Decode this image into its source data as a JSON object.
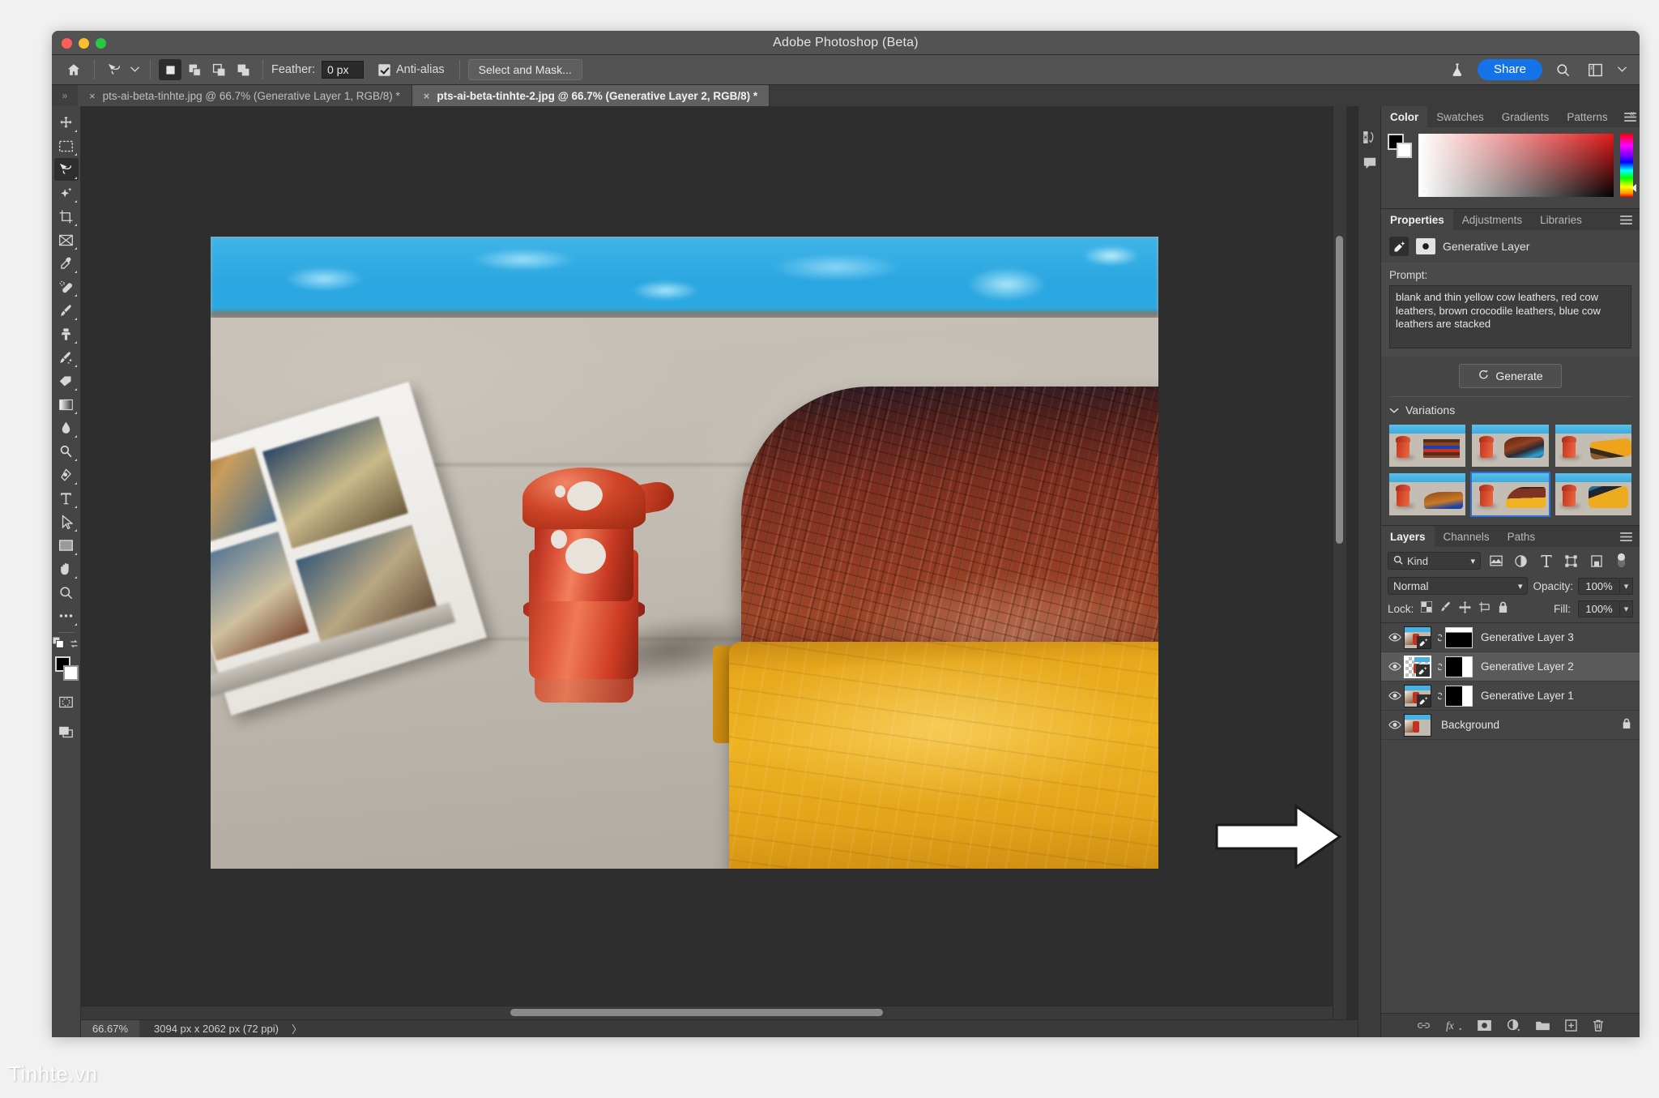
{
  "window": {
    "title": "Adobe Photoshop (Beta)",
    "traffic_lights": [
      "close",
      "minimize",
      "zoom"
    ]
  },
  "options_bar": {
    "home_icon": "home-icon",
    "tool_icon": "lasso-tool-icon",
    "tool_dropdown": "chevron-down-icon",
    "marquee_modes": [
      "new-selection",
      "add-to-selection",
      "subtract-from-selection",
      "intersect-selection"
    ],
    "feather_label": "Feather:",
    "feather_value": "0 px",
    "antialias_label": "Anti-alias",
    "antialias_checked": true,
    "select_and_mask_label": "Select and Mask...",
    "flask_icon": "flask-icon",
    "share_label": "Share",
    "search_icon": "search-icon",
    "workspace_icon": "workspace-icon",
    "workspace_chevron": "chevron-down-icon"
  },
  "tabs": {
    "gutter_icon": "expand-chevrons-icon",
    "items": [
      {
        "label": "pts-ai-beta-tinhte.jpg @ 66.7% (Generative Layer 1, RGB/8) *",
        "active": false,
        "close": "×"
      },
      {
        "label": "pts-ai-beta-tinhte-2.jpg @ 66.7% (Generative Layer 2, RGB/8) *",
        "active": true,
        "close": "×"
      }
    ]
  },
  "toolbar": {
    "tools": [
      {
        "name": "move-tool-icon",
        "active": false
      },
      {
        "name": "rectangular-marquee-tool-icon",
        "active": false
      },
      {
        "name": "lasso-tool-icon",
        "active": true
      },
      {
        "name": "object-selection-tool-icon",
        "active": false
      },
      {
        "name": "crop-tool-icon",
        "active": false
      },
      {
        "name": "frame-tool-icon",
        "active": false
      },
      {
        "name": "eyedropper-tool-icon",
        "active": false
      },
      {
        "name": "healing-brush-tool-icon",
        "active": false
      },
      {
        "name": "brush-tool-icon",
        "active": false
      },
      {
        "name": "clone-stamp-tool-icon",
        "active": false
      },
      {
        "name": "history-brush-tool-icon",
        "active": false
      },
      {
        "name": "eraser-tool-icon",
        "active": false
      },
      {
        "name": "gradient-tool-icon",
        "active": false
      },
      {
        "name": "blur-tool-icon",
        "active": false
      },
      {
        "name": "dodge-tool-icon",
        "active": false
      },
      {
        "name": "pen-tool-icon",
        "active": false
      },
      {
        "name": "type-tool-icon",
        "active": false
      },
      {
        "name": "path-selection-tool-icon",
        "active": false
      },
      {
        "name": "rectangle-tool-icon",
        "active": false
      },
      {
        "name": "hand-tool-icon",
        "active": false
      },
      {
        "name": "zoom-tool-icon",
        "active": false
      },
      {
        "name": "edit-toolbar-icon",
        "active": false
      }
    ],
    "default_colors_icon": "default-colors-icon",
    "swap-colors_icon": "swap-colors-icon",
    "foreground_color": "#000000",
    "background_color": "#ffffff",
    "quick_mask_icon": "quick-mask-icon",
    "screen_mode_icon": "screen-mode-icon"
  },
  "canvas": {
    "zoom": "66.67%",
    "dimensions": "3094 px x 2062 px (72 ppi)",
    "status_arrow": "〉",
    "image_description": "Red Vietnamese coffee filter on a pool deck beside a photo book, with a brown crocodile leather roll stacked over a yellow leather roll"
  },
  "rail": {
    "collapse_icon": "collapse-chevrons-icon",
    "icons": [
      "history-icon",
      "comments-icon"
    ]
  },
  "color_panel": {
    "tabs": [
      {
        "label": "Color",
        "active": true
      },
      {
        "label": "Swatches",
        "active": false
      },
      {
        "label": "Gradients",
        "active": false
      },
      {
        "label": "Patterns",
        "active": false
      }
    ],
    "menu_icon": "panel-menu-icon",
    "foreground": "#000000",
    "background": "#ffffff",
    "field_hue": "#e21c1c"
  },
  "properties_panel": {
    "tabs": [
      {
        "label": "Properties",
        "active": true
      },
      {
        "label": "Adjustments",
        "active": false
      },
      {
        "label": "Libraries",
        "active": false
      }
    ],
    "menu_icon": "panel-menu-icon",
    "layer_type_icon": "generative-layer-icon",
    "mask_icon": "layer-mask-icon",
    "layer_type_label": "Generative Layer",
    "prompt_label": "Prompt:",
    "prompt_value": "blank and thin yellow cow leathers, red cow leathers, brown crocodile leathers, blue cow leathers are stacked",
    "generate_label": "Generate",
    "generate_icon": "sparkle-icon",
    "variations_label": "Variations",
    "variations_chevron": "chevron-down-icon",
    "variations": [
      {
        "id": 1,
        "selected": false
      },
      {
        "id": 2,
        "selected": false
      },
      {
        "id": 3,
        "selected": false
      },
      {
        "id": 4,
        "selected": false
      },
      {
        "id": 5,
        "selected": true
      },
      {
        "id": 6,
        "selected": false
      }
    ]
  },
  "layers_panel": {
    "tabs": [
      {
        "label": "Layers",
        "active": true
      },
      {
        "label": "Channels",
        "active": false
      },
      {
        "label": "Paths",
        "active": false
      }
    ],
    "menu_icon": "panel-menu-icon",
    "filter_kind_label": "Kind",
    "filter_search_icon": "search-icon",
    "filter_chevron": "chevron-down-icon",
    "filter_icons": [
      "filter-pixel-icon",
      "filter-adjustment-icon",
      "filter-type-icon",
      "filter-shape-icon",
      "filter-smart-object-icon"
    ],
    "filter_toggle": "filter-toggle-switch",
    "blend_mode": "Normal",
    "opacity_label": "Opacity:",
    "opacity_value": "100%",
    "lock_label": "Lock:",
    "lock_icons": [
      "lock-transparent-pixels-icon",
      "lock-image-pixels-icon",
      "lock-position-icon",
      "lock-artboard-nesting-icon",
      "lock-all-icon"
    ],
    "fill_label": "Fill:",
    "fill_value": "100%",
    "layers": [
      {
        "name": "Generative Layer 3",
        "visible": true,
        "selected": false,
        "locked": false,
        "has_mask": true,
        "linked": true,
        "thumb": "photo",
        "mask_pattern": "top-white"
      },
      {
        "name": "Generative Layer 2",
        "visible": true,
        "selected": true,
        "locked": false,
        "has_mask": true,
        "linked": true,
        "thumb": "transparent",
        "mask_pattern": "right-white"
      },
      {
        "name": "Generative Layer 1",
        "visible": true,
        "selected": false,
        "locked": false,
        "has_mask": true,
        "linked": true,
        "thumb": "photo",
        "mask_pattern": "right-white"
      },
      {
        "name": "Background",
        "visible": true,
        "selected": false,
        "locked": true,
        "has_mask": false,
        "linked": false,
        "thumb": "photo",
        "mask_pattern": ""
      }
    ],
    "footer_icons": [
      "link-layers-icon",
      "layer-style-fx-icon",
      "add-layer-mask-icon",
      "new-adjustment-layer-icon",
      "new-group-icon",
      "new-layer-icon",
      "delete-layer-icon"
    ]
  },
  "annotation": {
    "arrow": "right-arrow-annotation"
  },
  "watermark": {
    "text": "Tinhte.vn"
  }
}
